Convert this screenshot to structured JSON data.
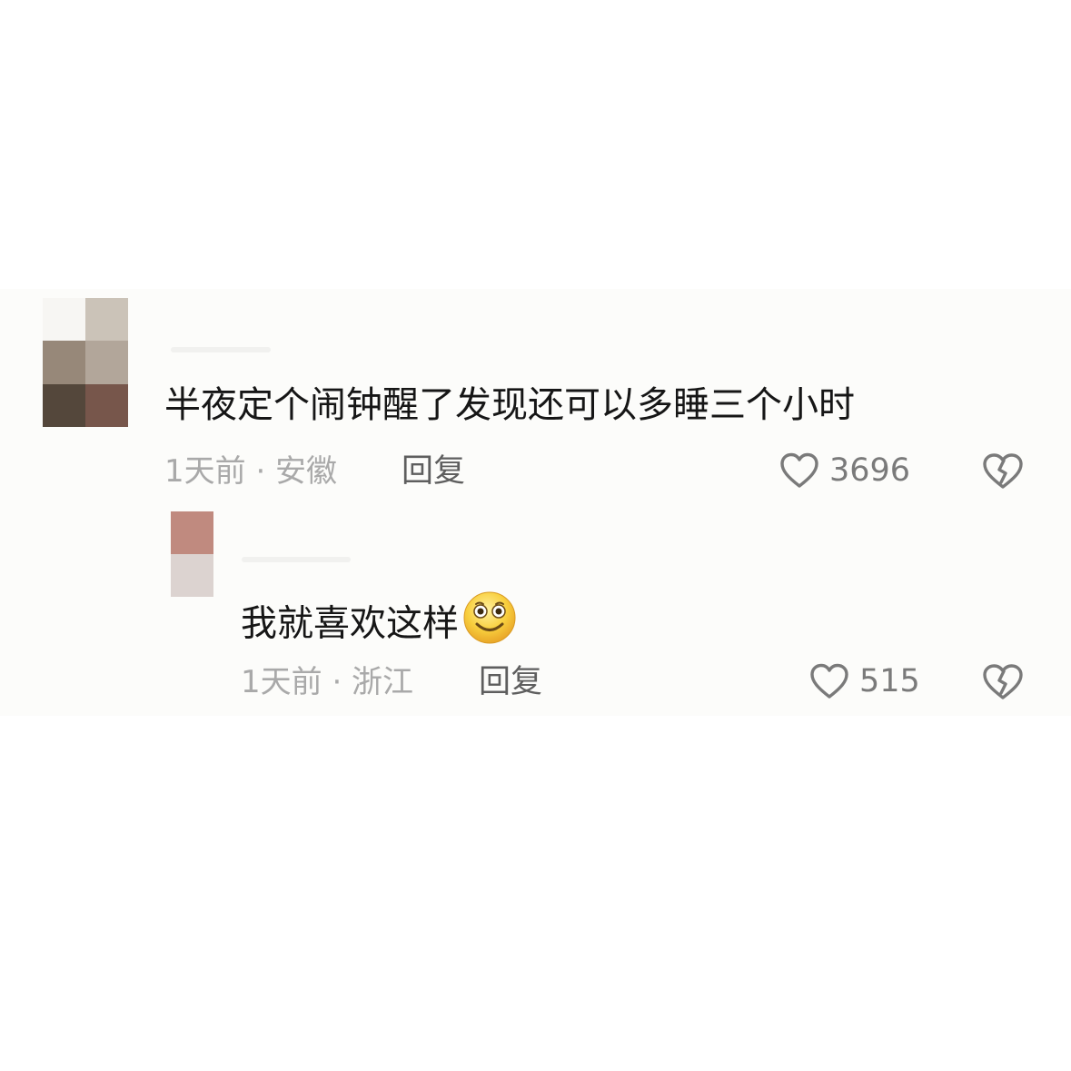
{
  "comments": [
    {
      "text": "半夜定个闹钟醒了发现还可以多睡三个小时",
      "time_location": "1天前 · 安徽",
      "reply_label": "回复",
      "likes": "3696",
      "avatar_colors": [
        "#f7f6f3",
        "#cbc3b8",
        "#978879",
        "#b2a69a",
        "#54473b",
        "#77564b"
      ]
    },
    {
      "text": "我就喜欢这样",
      "emoji": "smiling-emoji",
      "time_location": "1天前 · 浙江",
      "reply_label": "回复",
      "likes": "515",
      "avatar_colors": [
        "#c08a7f",
        "#dcd3d0"
      ]
    }
  ],
  "icons": {
    "like": "heart-outline-icon",
    "dislike": "broken-heart-icon"
  },
  "colors": {
    "text": "#161616",
    "meta": "#a9a9a9",
    "reply": "#5e5e5e",
    "icon": "#7a7a7a"
  }
}
